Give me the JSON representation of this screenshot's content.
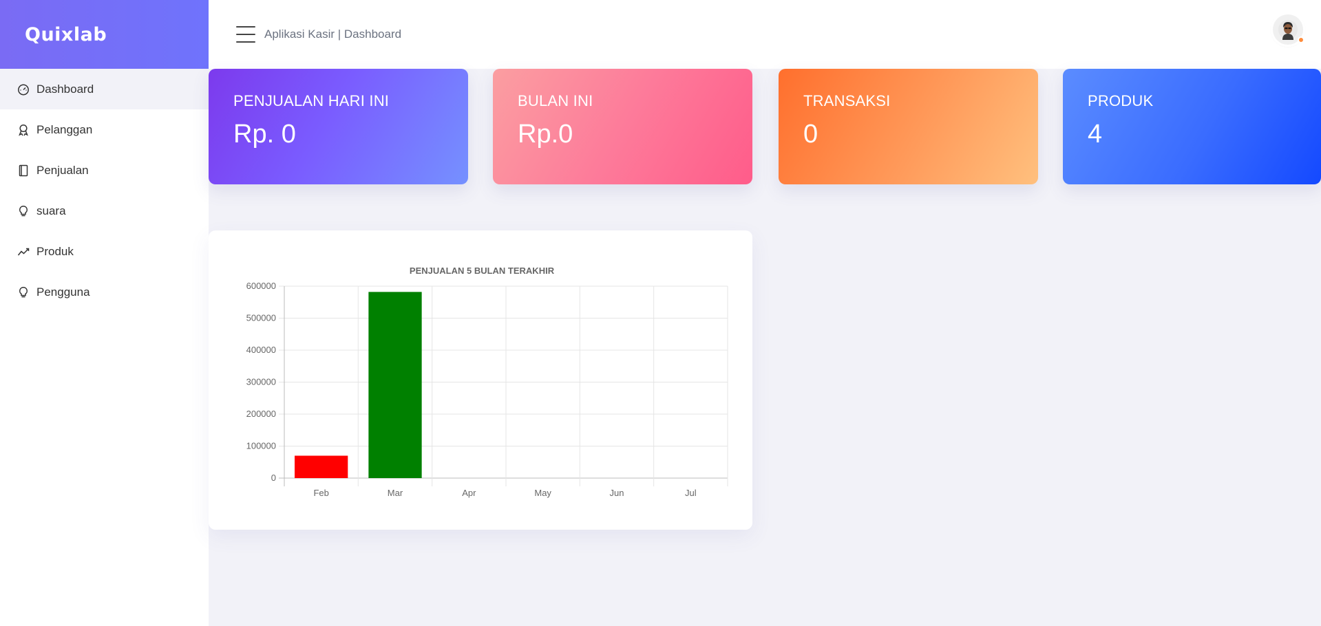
{
  "brand": "Quixlab",
  "sidebar": {
    "items": [
      {
        "label": "Dashboard",
        "icon": "speedometer-icon",
        "active": true
      },
      {
        "label": "Pelanggan",
        "icon": "award-icon",
        "active": false
      },
      {
        "label": "Penjualan",
        "icon": "notebook-icon",
        "active": false
      },
      {
        "label": "suara",
        "icon": "bulb-icon",
        "active": false
      },
      {
        "label": "Produk",
        "icon": "graph-icon",
        "active": false
      },
      {
        "label": "Pengguna",
        "icon": "bulb-icon",
        "active": false
      }
    ]
  },
  "header": {
    "title": "Aplikasi Kasir | Dashboard",
    "menu_icon": "hamburger-icon",
    "avatar_icon": "user-avatar-icon",
    "avatar_status_color": "#ff8c3b"
  },
  "stats": [
    {
      "label": "PENJUALAN HARI INI",
      "value": "Rp. 0"
    },
    {
      "label": "BULAN INI",
      "value": "Rp.0"
    },
    {
      "label": "TRANSAKSI",
      "value": "0"
    },
    {
      "label": "PRODUK",
      "value": "4"
    }
  ],
  "colors": {
    "brand": "#7a6bf4",
    "card1": "#7c3aed",
    "card2": "#ff5c8a",
    "card3": "#ff8c3b",
    "card4": "#1449ff"
  },
  "chart_data": {
    "type": "bar",
    "title": "PENJUALAN 5 BULAN TERAKHIR",
    "categories": [
      "Feb",
      "Mar",
      "Apr",
      "May",
      "Jun",
      "Jul"
    ],
    "values": [
      70000,
      582000,
      0,
      0,
      0,
      0
    ],
    "bar_colors": [
      "#ff0000",
      "#008000",
      "#000000",
      "#000000",
      "#000000",
      "#000000"
    ],
    "yticks": [
      "0",
      "100000",
      "200000",
      "300000",
      "400000",
      "500000",
      "600000"
    ],
    "ylim": [
      0,
      600000
    ],
    "grid": true,
    "legend": false
  }
}
